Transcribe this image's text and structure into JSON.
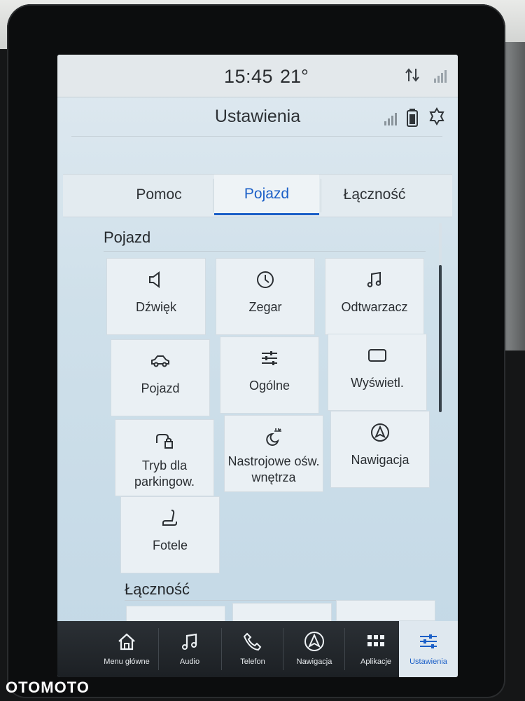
{
  "status": {
    "time": "15:45",
    "temperature": "21°"
  },
  "header": {
    "title": "Ustawienia"
  },
  "tabs": [
    {
      "label": "Pomoc"
    },
    {
      "label": "Pojazd",
      "active": true
    },
    {
      "label": "Łączność"
    }
  ],
  "sections": {
    "vehicle": {
      "title": "Pojazd",
      "tiles": [
        {
          "label": "Dźwięk",
          "icon": "speaker-icon"
        },
        {
          "label": "Zegar",
          "icon": "clock-icon"
        },
        {
          "label": "Odtwarzacz",
          "icon": "music-note-icon"
        },
        {
          "label": "Pojazd",
          "icon": "car-icon"
        },
        {
          "label": "Ogólne",
          "icon": "sliders-icon"
        },
        {
          "label": "Wyświetl.",
          "icon": "display-icon"
        },
        {
          "label": "Tryb dla parkingow.",
          "icon": "car-lock-icon"
        },
        {
          "label": "Nastrojowe ośw. wnętrza",
          "icon": "ambient-light-icon"
        },
        {
          "label": "Nawigacja",
          "icon": "navigation-arrow-icon"
        },
        {
          "label": "Fotele",
          "icon": "seat-icon"
        }
      ]
    },
    "connectivity": {
      "title": "Łączność"
    }
  },
  "bottom_nav": [
    {
      "label": "Menu główne",
      "icon": "home-icon"
    },
    {
      "label": "Audio",
      "icon": "music-note-icon"
    },
    {
      "label": "Telefon",
      "icon": "phone-icon"
    },
    {
      "label": "Nawigacja",
      "icon": "navigation-arrow-icon"
    },
    {
      "label": "Aplikacje",
      "icon": "apps-grid-icon"
    },
    {
      "label": "Ustawienia",
      "icon": "settings-sliders-icon",
      "active": true
    }
  ],
  "watermark": "OTOMOTO",
  "colors": {
    "accent": "#1b5fc7",
    "nav_bg": "#23282c",
    "screen_bg": "#cfe0ea"
  }
}
